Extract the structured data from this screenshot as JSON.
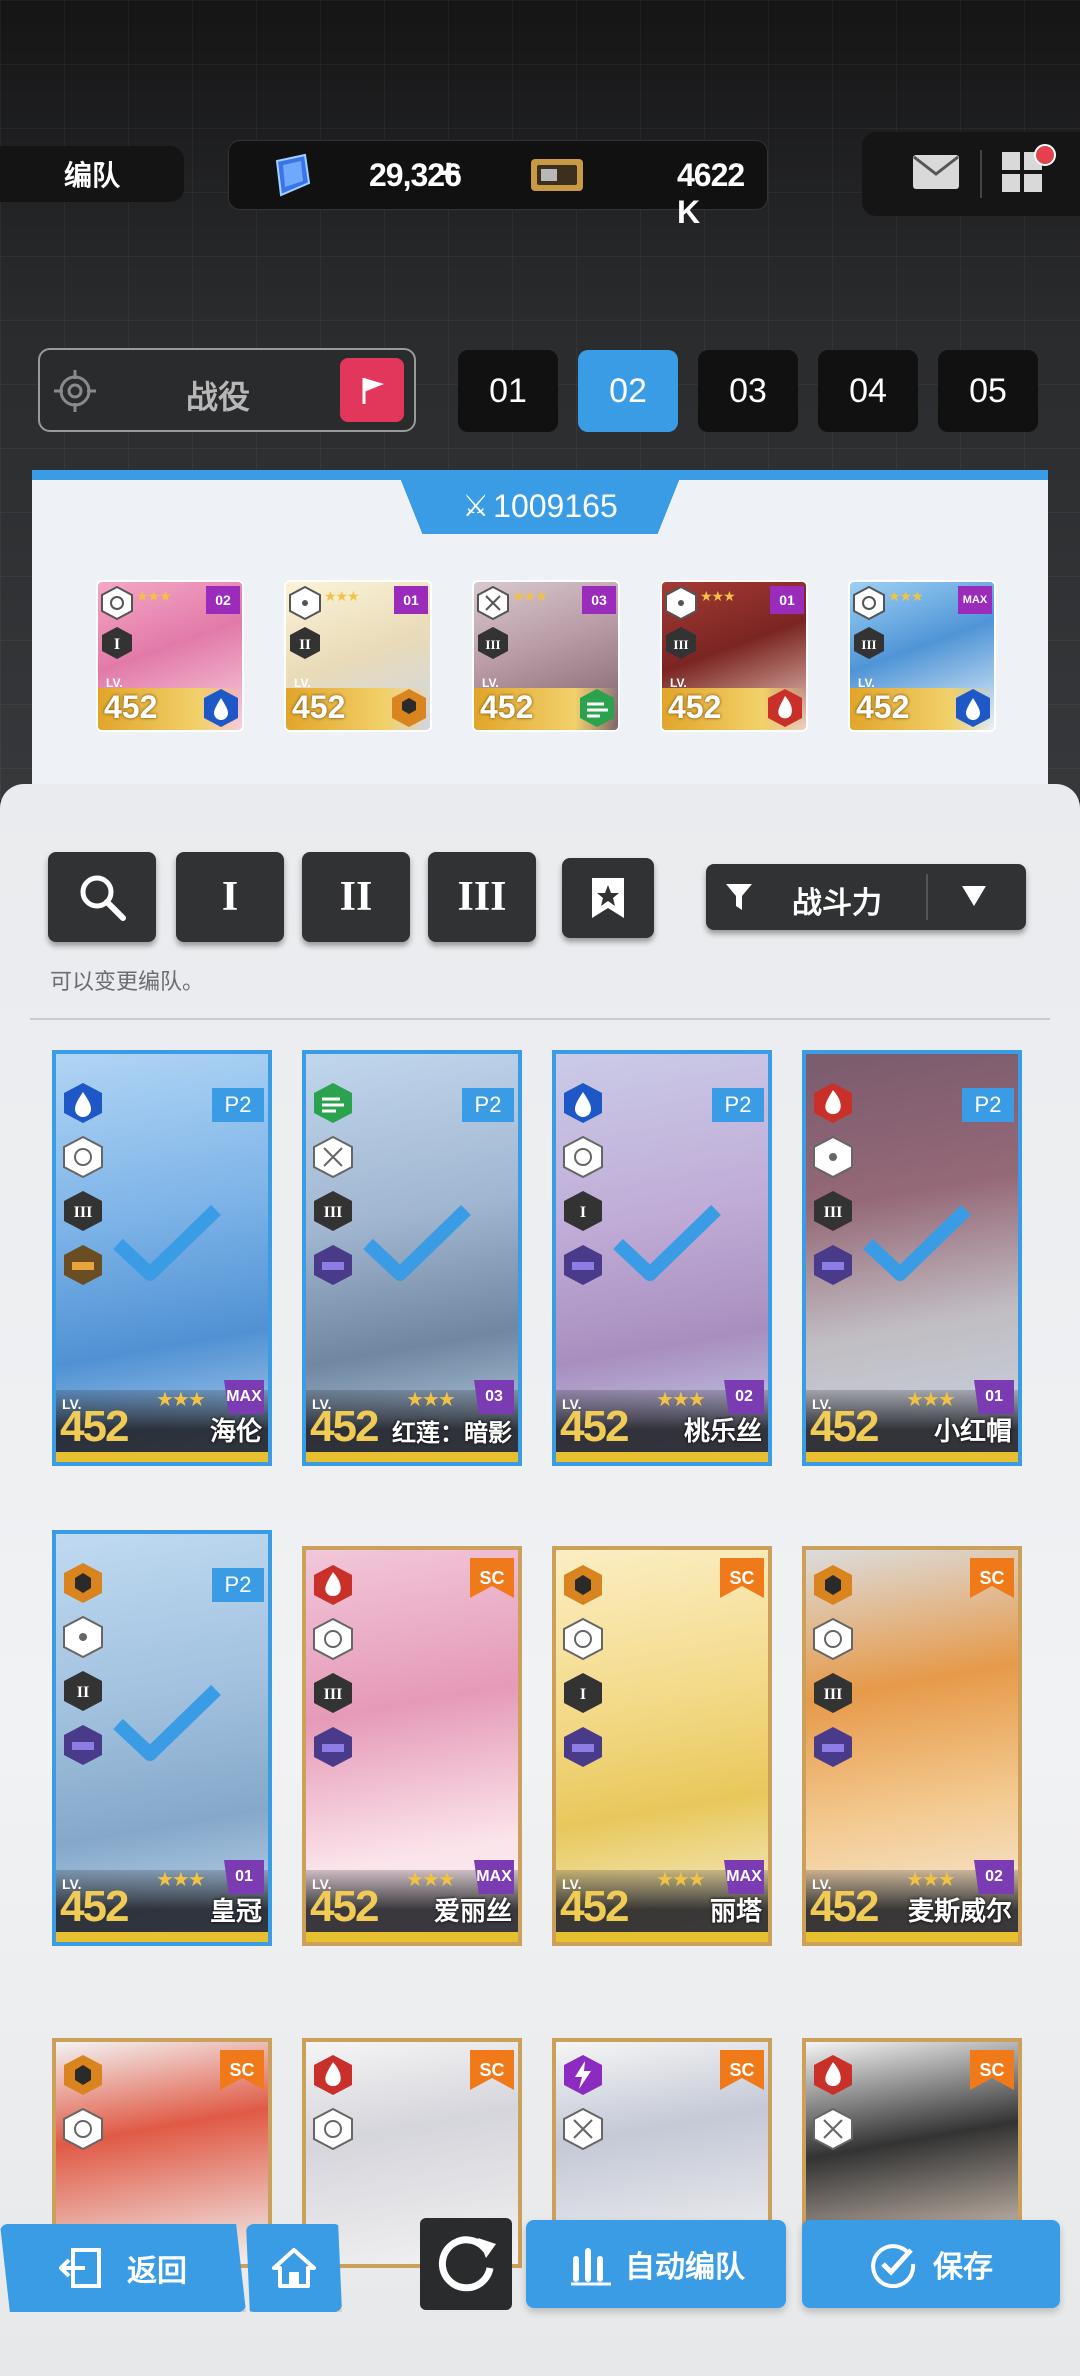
{
  "header": {
    "title": "编队",
    "gems": "29,326",
    "plus": "+",
    "credits": "4622 K"
  },
  "campaign": {
    "label": "战役"
  },
  "team_tabs": [
    "01",
    "02",
    "03",
    "04",
    "05"
  ],
  "active_tab": "02",
  "team": {
    "power": "1009165",
    "members": [
      {
        "lv": "452",
        "class": "I",
        "lb": "02",
        "element": "water"
      },
      {
        "lv": "452",
        "class": "II",
        "lb": "01",
        "element": "iron"
      },
      {
        "lv": "452",
        "class": "III",
        "lb": "03",
        "element": "wind"
      },
      {
        "lv": "452",
        "class": "III",
        "lb": "01",
        "element": "fire"
      },
      {
        "lv": "452",
        "class": "III",
        "lb": "MAX",
        "element": "water"
      }
    ]
  },
  "toolbar": {
    "search": "search-icon",
    "burst1": "I",
    "burst2": "II",
    "burst3": "III",
    "favorite": "bookmark-star-icon",
    "sort_label": "战斗力"
  },
  "hint": "可以变更编队。",
  "roster": [
    {
      "name": "海伦",
      "lv": "452",
      "lb": "MAX",
      "badge": "P2",
      "selected": true
    },
    {
      "name": "红莲：暗影",
      "lv": "452",
      "lb": "03",
      "badge": "P2",
      "selected": true
    },
    {
      "name": "桃乐丝",
      "lv": "452",
      "lb": "02",
      "badge": "P2",
      "selected": true
    },
    {
      "name": "小红帽",
      "lv": "452",
      "lb": "01",
      "badge": "P2",
      "selected": true
    },
    {
      "name": "皇冠",
      "lv": "452",
      "lb": "01",
      "badge": "P2",
      "selected": true
    },
    {
      "name": "爱丽丝",
      "lv": "452",
      "lb": "MAX",
      "badge": "SC",
      "selected": false
    },
    {
      "name": "丽塔",
      "lv": "452",
      "lb": "MAX",
      "badge": "SC",
      "selected": false
    },
    {
      "name": "麦斯威尔",
      "lv": "452",
      "lb": "02",
      "badge": "SC",
      "selected": false
    }
  ],
  "roster_partial": [
    {
      "badge": "SC"
    },
    {
      "badge": "SC"
    },
    {
      "badge": "SC"
    },
    {
      "badge": "SC"
    }
  ],
  "lv_label": "LV.",
  "buttons": {
    "back": "返回",
    "auto": "自动编队",
    "save": "保存"
  },
  "colors": {
    "accent": "#3b9ce6",
    "campaign_flag": "#e2365b",
    "gold": "#e8bf2f"
  }
}
